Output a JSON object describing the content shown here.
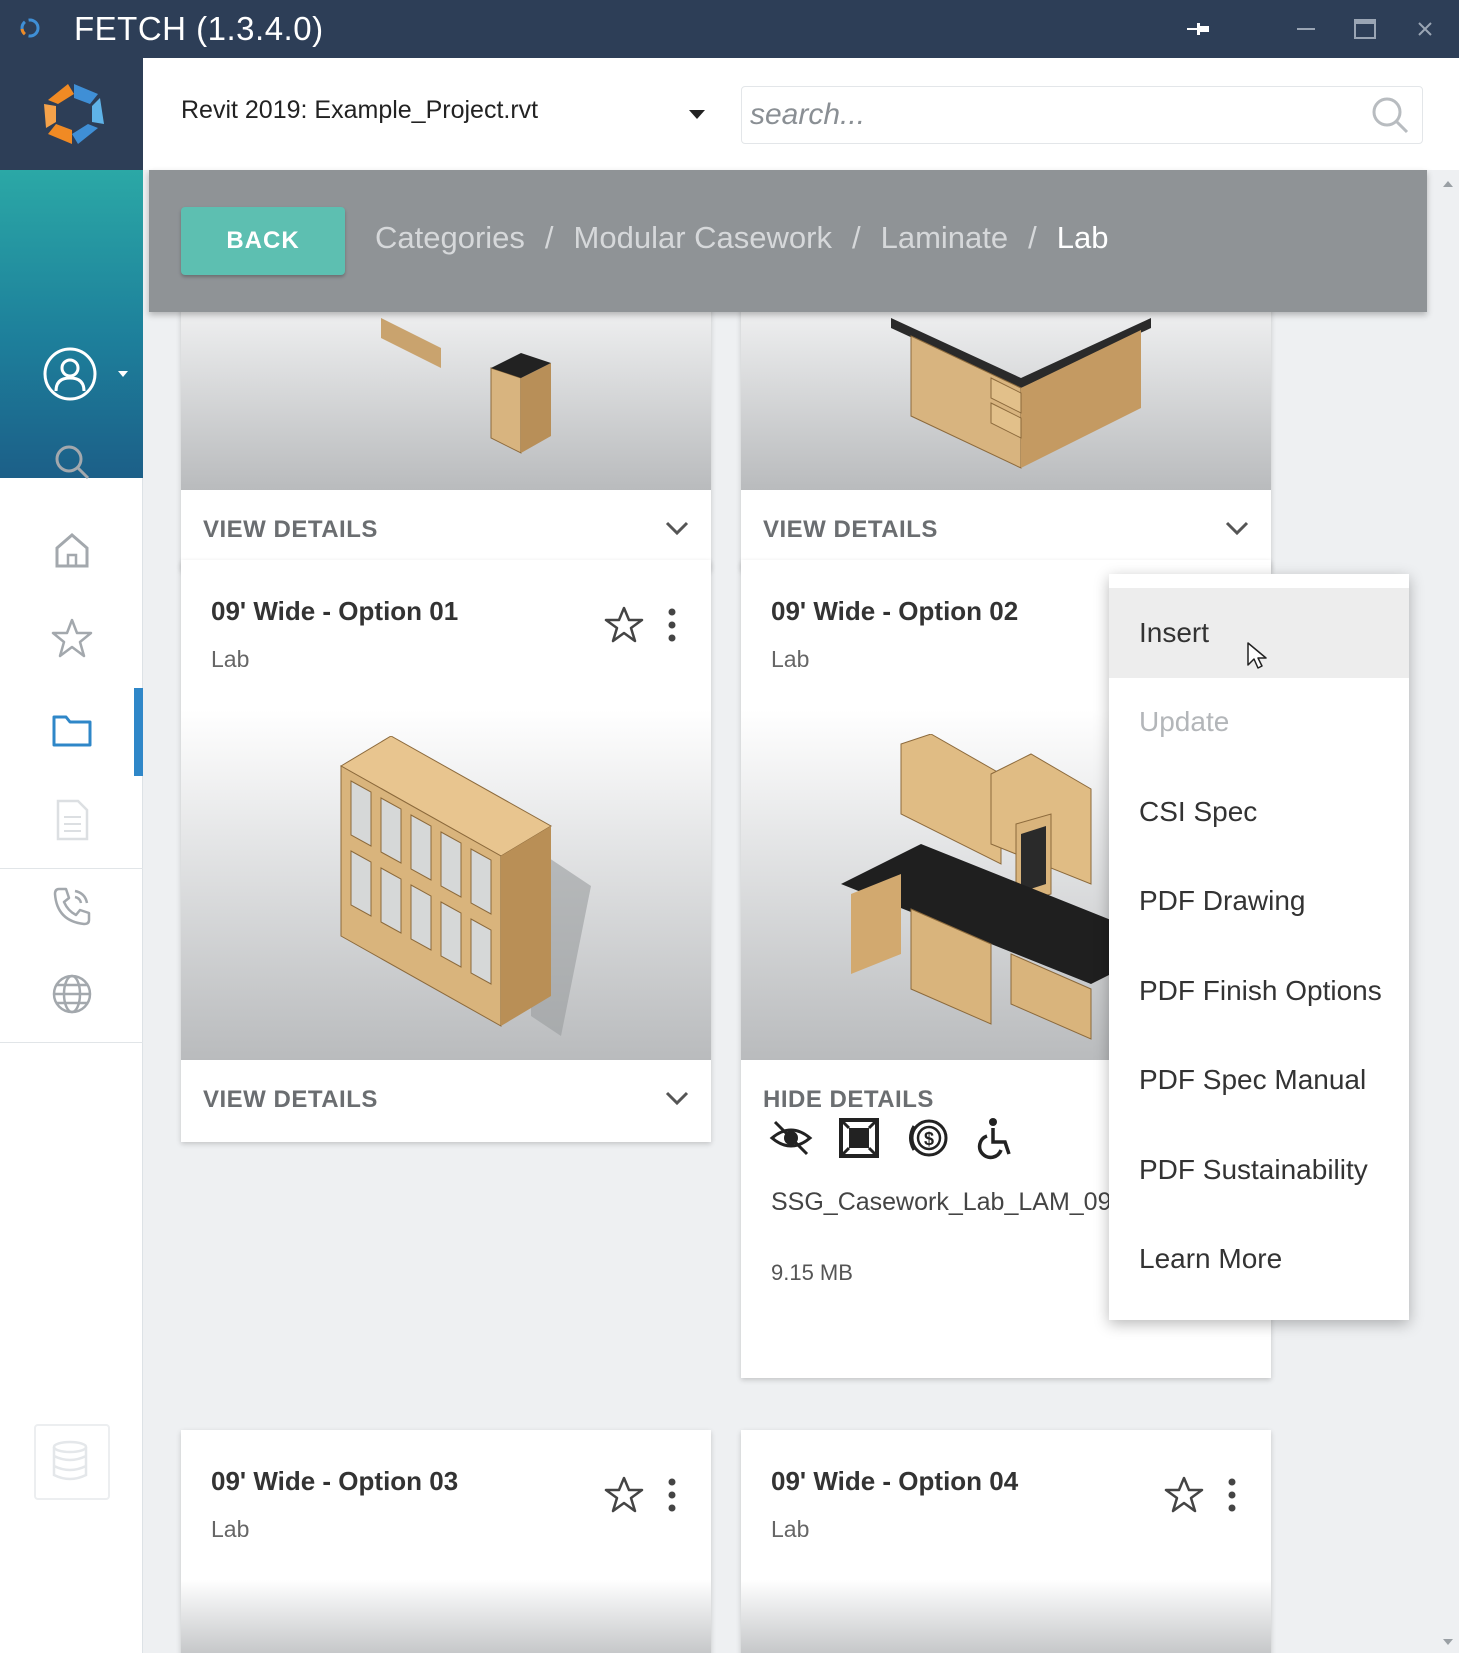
{
  "window": {
    "title": "FETCH (1.3.4.0)",
    "pin_icon": "pin-icon",
    "minimize_icon": "minimize-icon",
    "maximize_icon": "maximize-icon",
    "close_icon": "close-icon"
  },
  "sidebar": {
    "logo": "fetch-logo-icon",
    "profile_icon": "user-circle-icon",
    "nav": [
      {
        "name": "search",
        "icon": "search-icon"
      },
      {
        "name": "home",
        "icon": "home-icon"
      },
      {
        "name": "favorites",
        "icon": "star-icon"
      },
      {
        "name": "browse",
        "icon": "folder-icon",
        "active": true
      },
      {
        "name": "documents",
        "icon": "document-icon"
      },
      {
        "name": "contact",
        "icon": "phone-icon"
      },
      {
        "name": "web",
        "icon": "globe-icon"
      }
    ],
    "bottom_icon": "database-icon",
    "accent": "#2f87c8"
  },
  "header": {
    "project": "Revit 2019: Example_Project.rvt",
    "search_placeholder": "search..."
  },
  "breadcrumb": {
    "back_label": "BACK",
    "items": [
      "Categories",
      "Modular Casework",
      "Laminate"
    ],
    "current": "Lab",
    "separator": "/"
  },
  "cards": {
    "top_left": {
      "footer": "VIEW DETAILS"
    },
    "top_right": {
      "footer": "VIEW DETAILS"
    },
    "opt1": {
      "title": "09' Wide - Option 01",
      "subtitle": "Lab",
      "footer": "VIEW DETAILS"
    },
    "opt2": {
      "title": "09' Wide - Option 02",
      "subtitle": "Lab",
      "footer": "HIDE DETAILS",
      "attributes": [
        "hidden-eye-icon",
        "frame-icon",
        "coin-icon",
        "accessibility-icon"
      ],
      "file_name": "SSG_Casework_Lab_LAM_09",
      "file_size": "9.15 MB"
    },
    "opt3": {
      "title": "09' Wide - Option 03",
      "subtitle": "Lab"
    },
    "opt4": {
      "title": "09' Wide - Option 04",
      "subtitle": "Lab"
    }
  },
  "context_menu": {
    "items": [
      {
        "label": "Insert",
        "state": "hover"
      },
      {
        "label": "Update",
        "state": "disabled"
      },
      {
        "label": "CSI Spec",
        "state": "normal"
      },
      {
        "label": "PDF Drawing",
        "state": "normal"
      },
      {
        "label": "PDF Finish Options",
        "state": "normal"
      },
      {
        "label": "PDF Spec Manual",
        "state": "normal"
      },
      {
        "label": "PDF Sustainability",
        "state": "normal"
      },
      {
        "label": "Learn More",
        "state": "normal"
      }
    ]
  },
  "colors": {
    "titlebar": "#2d3e57",
    "back_button": "#5dbfb1",
    "breadcrumb_bar": "#8f9396"
  }
}
